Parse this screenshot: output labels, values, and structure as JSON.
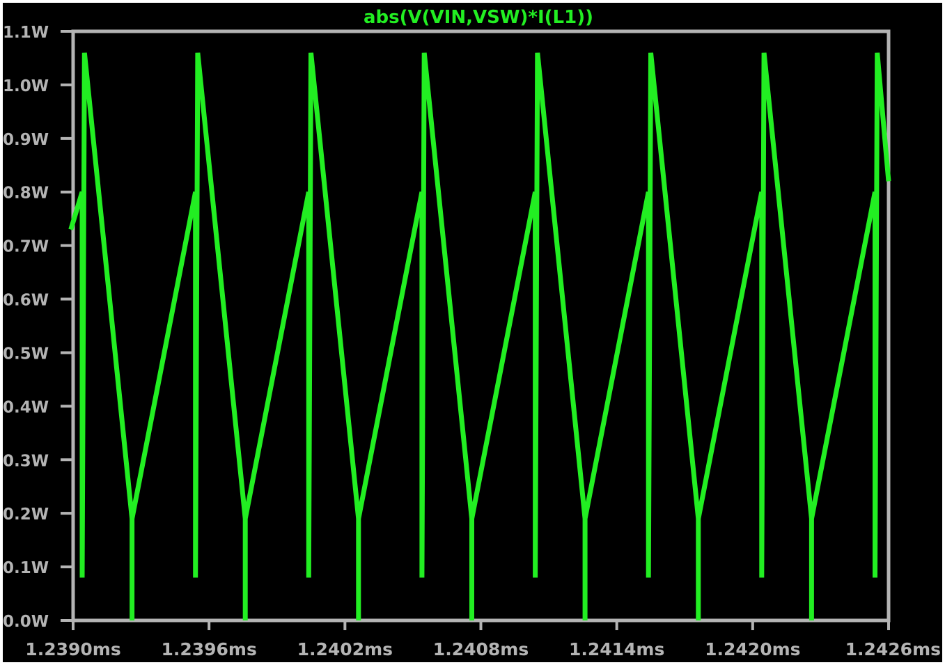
{
  "chart_data": {
    "type": "line",
    "title": "abs(V(VIN,VSW)*I(L1))",
    "x_unit": "ms",
    "y_unit": "W",
    "xlim": [
      1.239,
      1.2426
    ],
    "ylim": [
      0.0,
      1.1
    ],
    "x_ticks": [
      "1.2390ms",
      "1.2396ms",
      "1.2402ms",
      "1.2408ms",
      "1.2414ms",
      "1.2420ms",
      "1.2426ms"
    ],
    "y_ticks": [
      "0.0W",
      "0.1W",
      "0.2W",
      "0.3W",
      "0.4W",
      "0.5W",
      "0.6W",
      "0.7W",
      "0.8W",
      "0.9W",
      "1.0W",
      "1.1W"
    ],
    "grid": false,
    "series": [
      {
        "color": "#22ee22",
        "x": [
          1.23899,
          1.23904,
          1.23904,
          1.23905,
          1.23926,
          1.23926,
          1.23926,
          1.23954,
          1.23954,
          1.23955,
          1.23976,
          1.23976,
          1.23976,
          1.24004,
          1.24004,
          1.24005,
          1.24026,
          1.24026,
          1.24026,
          1.24054,
          1.24054,
          1.24055,
          1.24076,
          1.24076,
          1.24076,
          1.24104,
          1.24104,
          1.24105,
          1.24126,
          1.24126,
          1.24126,
          1.24154,
          1.24154,
          1.24155,
          1.24176,
          1.24176,
          1.24176,
          1.24204,
          1.24204,
          1.24205,
          1.24226,
          1.24226,
          1.24226,
          1.24254,
          1.24254,
          1.24255,
          1.2426
        ],
        "y": [
          0.73,
          0.8,
          0.08,
          1.06,
          0.19,
          0.0,
          0.19,
          0.8,
          0.08,
          1.06,
          0.19,
          0.0,
          0.19,
          0.8,
          0.08,
          1.06,
          0.19,
          0.0,
          0.19,
          0.8,
          0.08,
          1.06,
          0.19,
          0.0,
          0.19,
          0.8,
          0.08,
          1.06,
          0.19,
          0.0,
          0.19,
          0.8,
          0.08,
          1.06,
          0.19,
          0.0,
          0.19,
          0.8,
          0.08,
          1.06,
          0.19,
          0.0,
          0.19,
          0.8,
          0.08,
          1.06,
          0.82
        ]
      }
    ]
  },
  "colors": {
    "background": "#000000",
    "axis": "#b4b4b4",
    "trace": "#22ee22",
    "title": "#22ee22",
    "tick_label": "#b4b4b4"
  }
}
